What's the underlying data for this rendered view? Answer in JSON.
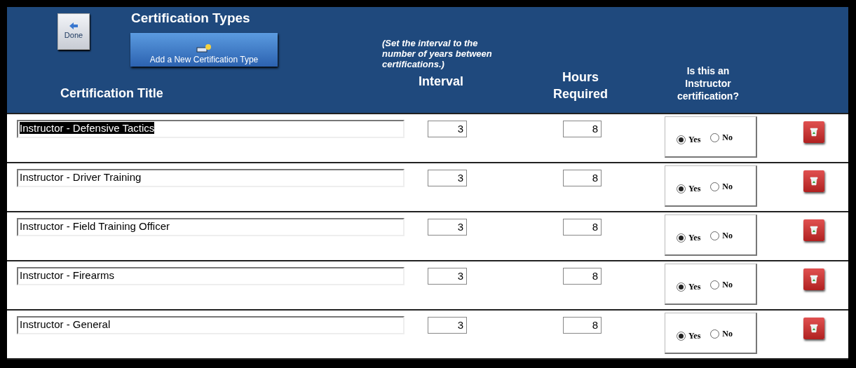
{
  "header": {
    "title": "Certification Types",
    "done_button": "Done",
    "add_button": "Add a New Certification Type",
    "columns": {
      "title": "Certification Title",
      "interval_note": "(Set the interval to the number of years between certifications.)",
      "interval": "Interval",
      "hours": "Hours Required",
      "instructor": "Is this an Instructor certification?"
    }
  },
  "rows": [
    {
      "title": "Instructor - Defensive Tactics",
      "text_selected": true,
      "interval": "3",
      "hours": "8",
      "options": [
        {
          "label": "Yes",
          "selected": true
        },
        {
          "label": "No",
          "selected": false
        }
      ]
    },
    {
      "title": "Instructor - Driver Training",
      "text_selected": false,
      "interval": "3",
      "hours": "8",
      "options": [
        {
          "label": "Yes",
          "selected": true
        },
        {
          "label": "No",
          "selected": false
        }
      ]
    },
    {
      "title": "Instructor - Field Training Officer",
      "text_selected": false,
      "interval": "3",
      "hours": "8",
      "options": [
        {
          "label": "Yes",
          "selected": true
        },
        {
          "label": "No",
          "selected": false
        }
      ]
    },
    {
      "title": "Instructor - Firearms",
      "text_selected": false,
      "interval": "3",
      "hours": "8",
      "options": [
        {
          "label": "Yes",
          "selected": true
        },
        {
          "label": "No",
          "selected": false
        }
      ]
    },
    {
      "title": "Instructor - General",
      "text_selected": false,
      "interval": "3",
      "hours": "8",
      "options": [
        {
          "label": "Yes",
          "selected": true
        },
        {
          "label": "No",
          "selected": false
        }
      ]
    }
  ]
}
